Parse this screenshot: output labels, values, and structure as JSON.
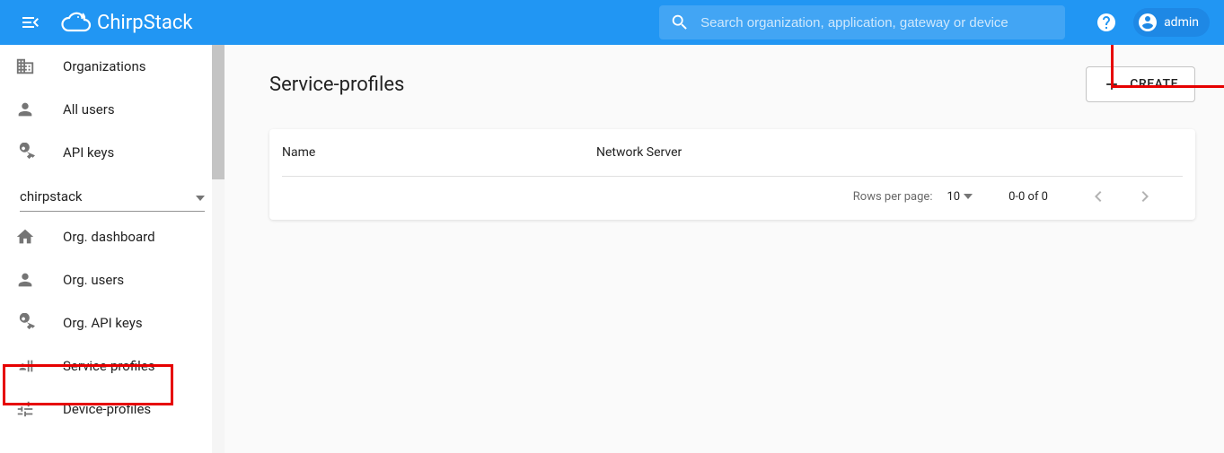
{
  "header": {
    "brand": "ChirpStack",
    "search_placeholder": "Search organization, application, gateway or device",
    "user": "admin"
  },
  "sidebar": {
    "top": [
      {
        "icon": "domain",
        "label": "Organizations"
      },
      {
        "icon": "person",
        "label": "All users"
      },
      {
        "icon": "key",
        "label": "API keys"
      }
    ],
    "org_select": {
      "value": "chirpstack"
    },
    "org_items": [
      {
        "icon": "home",
        "label": "Org. dashboard"
      },
      {
        "icon": "person",
        "label": "Org. users"
      },
      {
        "icon": "key",
        "label": "Org. API keys"
      },
      {
        "icon": "profile",
        "label": "Service-profiles"
      },
      {
        "icon": "tune",
        "label": "Device-profiles"
      }
    ]
  },
  "page": {
    "title": "Service-profiles",
    "create_label": "CREATE",
    "columns": {
      "name": "Name",
      "ns": "Network Server"
    },
    "pager": {
      "rows_label": "Rows per page:",
      "rows_value": "10",
      "range": "0-0 of 0"
    }
  }
}
